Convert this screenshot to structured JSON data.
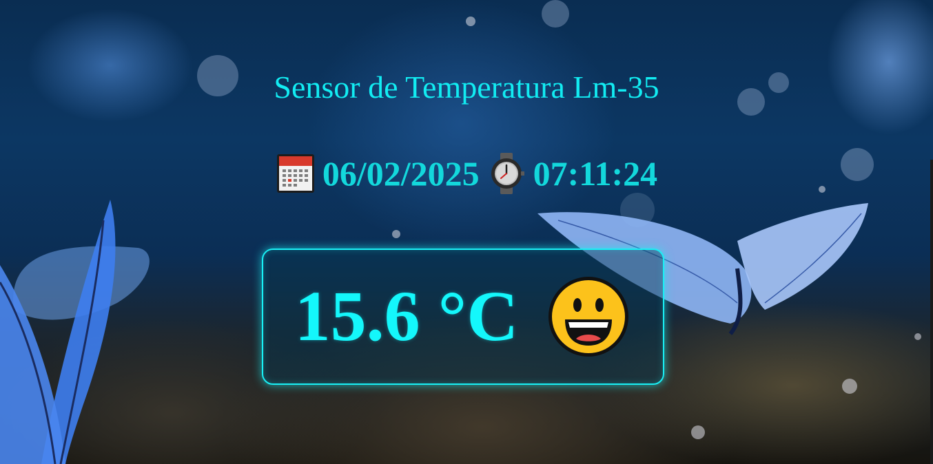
{
  "header": {
    "title": "Sensor de Temperatura Lm-35"
  },
  "datetime": {
    "calendar_icon": "calendar-icon",
    "date": "06/02/2025",
    "clock_icon": "watch-icon",
    "time": "07:11:24"
  },
  "reading": {
    "temperature": "15.6 °C",
    "status_icon": "grinning-face-icon"
  },
  "colors": {
    "accent": "#12ecf2",
    "datetime": "#13d8dc",
    "card_border": "#19f0f5"
  }
}
